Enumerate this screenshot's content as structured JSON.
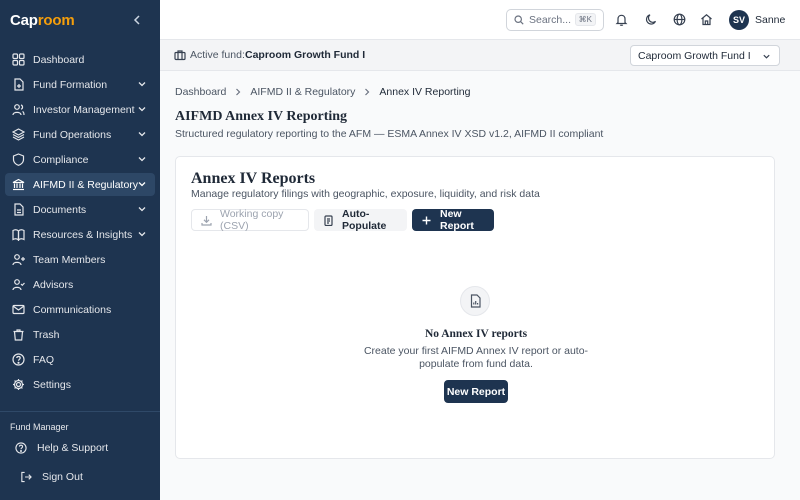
{
  "app": {
    "logo_prefix": "Cap",
    "logo_suffix": "room",
    "accent_color": "#f59e0b",
    "sidebar_color": "#1e3450"
  },
  "sidebar": {
    "items": [
      {
        "label": "Dashboard",
        "icon": "grid-icon",
        "expandable": false
      },
      {
        "label": "Fund Formation",
        "icon": "file-plus-icon",
        "expandable": true
      },
      {
        "label": "Investor Management",
        "icon": "users-icon",
        "expandable": true
      },
      {
        "label": "Fund Operations",
        "icon": "layers-icon",
        "expandable": true
      },
      {
        "label": "Compliance",
        "icon": "shield-icon",
        "expandable": true
      },
      {
        "label": "AIFMD II & Regulatory",
        "icon": "bank-icon",
        "expandable": true,
        "active": true
      },
      {
        "label": "Documents",
        "icon": "document-icon",
        "expandable": true
      },
      {
        "label": "Resources & Insights",
        "icon": "book-icon",
        "expandable": true
      },
      {
        "label": "Team Members",
        "icon": "user-plus-icon",
        "expandable": false
      },
      {
        "label": "Advisors",
        "icon": "user-check-icon",
        "expandable": false
      },
      {
        "label": "Communications",
        "icon": "mail-icon",
        "expandable": false
      },
      {
        "label": "Trash",
        "icon": "trash-icon",
        "expandable": false
      },
      {
        "label": "FAQ",
        "icon": "help-circle-icon",
        "expandable": false
      },
      {
        "label": "Settings",
        "icon": "gear-icon",
        "expandable": false
      }
    ],
    "role": "Fund Manager",
    "help_label": "Help & Support",
    "signout_label": "Sign Out"
  },
  "topbar": {
    "search_placeholder": "Search...",
    "search_shortcut": "⌘K",
    "avatar_initials": "SV",
    "username": "Sanne"
  },
  "fundbar": {
    "active_label": "Active fund:",
    "active_fund": "Caproom Growth Fund I",
    "selected_fund": "Caproom Growth Fund I"
  },
  "breadcrumb": [
    "Dashboard",
    "AIFMD II & Regulatory",
    "Annex IV Reporting"
  ],
  "page": {
    "title": "AIFMD Annex IV Reporting",
    "subtitle": "Structured regulatory reporting to the AFM — ESMA Annex IV XSD v1.2, AIFMD II compliant"
  },
  "card": {
    "title": "Annex IV Reports",
    "subtitle": "Manage regulatory filings with geographic, exposure, liquidity, and risk data",
    "btn_csv": "Working copy (CSV)",
    "btn_autopopulate": "Auto-Populate",
    "btn_new": "New Report",
    "empty_title": "No Annex IV reports",
    "empty_desc": "Create your first AIFMD Annex IV report or auto-populate from fund data.",
    "empty_btn": "New Report"
  }
}
